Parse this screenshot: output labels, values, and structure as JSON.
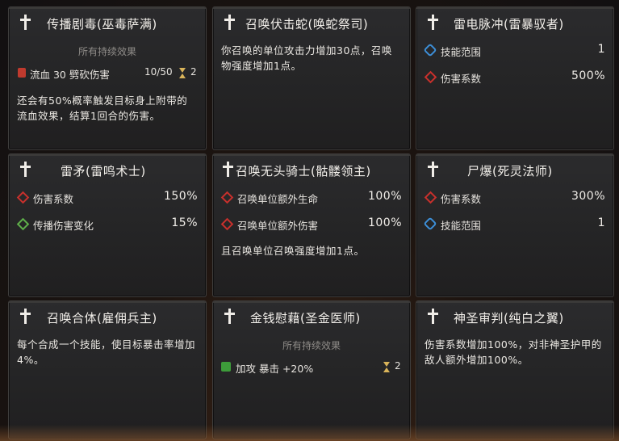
{
  "cards": [
    {
      "title": "传播剧毒(巫毒萨满)",
      "subtitle": "所有持续效果",
      "effect": {
        "label": "流血 30 劈砍伤害",
        "stack": "10/50",
        "duration": "2",
        "icon": "blood-drop-icon"
      },
      "description": "还会有50%概率触发目标身上附带的流血效果，结算1回合的伤害。"
    },
    {
      "title": "召唤伏击蛇(唤蛇祭司)",
      "description": "你召唤的单位攻击力增加30点，召唤物强度增加1点。"
    },
    {
      "title": "雷电脉冲(雷暴驭者)",
      "stats": [
        {
          "label": "技能范围",
          "value": "1",
          "icon": "range-icon"
        },
        {
          "label": "伤害系数",
          "value": "500%",
          "icon": "damage-icon"
        }
      ]
    },
    {
      "title": "雷矛(雷鸣术士)",
      "stats": [
        {
          "label": "伤害系数",
          "value": "150%",
          "icon": "damage-icon"
        },
        {
          "label": "传播伤害变化",
          "value": "15%",
          "icon": "spread-icon"
        }
      ]
    },
    {
      "title": "召唤无头骑士(骷髅领主)",
      "stats": [
        {
          "label": "召唤单位额外生命",
          "value": "100%",
          "icon": "summon-life-icon"
        },
        {
          "label": "召唤单位额外伤害",
          "value": "100%",
          "icon": "summon-damage-icon"
        }
      ],
      "description": "且召唤单位召唤强度增加1点。"
    },
    {
      "title": "尸爆(死灵法师)",
      "stats": [
        {
          "label": "伤害系数",
          "value": "300%",
          "icon": "damage-icon"
        },
        {
          "label": "技能范围",
          "value": "1",
          "icon": "range-icon"
        }
      ]
    },
    {
      "title": "召唤合体(雇佣兵主)",
      "description": "每个合成一个技能，使目标暴击率增加4%。"
    },
    {
      "title": "金钱慰藉(圣金医师)",
      "subtitle": "所有持续效果",
      "effect": {
        "label": "加攻 暴击 +20%",
        "duration": "2",
        "icon": "attack-buff-icon"
      }
    },
    {
      "title": "神圣审判(纯白之翼)",
      "description": "伤害系数增加100%，对非神圣护甲的敌人额外增加100%。"
    }
  ],
  "colors": {
    "accent_red": "#c9302c",
    "accent_blue": "#3d8fd8",
    "accent_green": "#5fb04a",
    "hourglass": "#d9b45a"
  }
}
